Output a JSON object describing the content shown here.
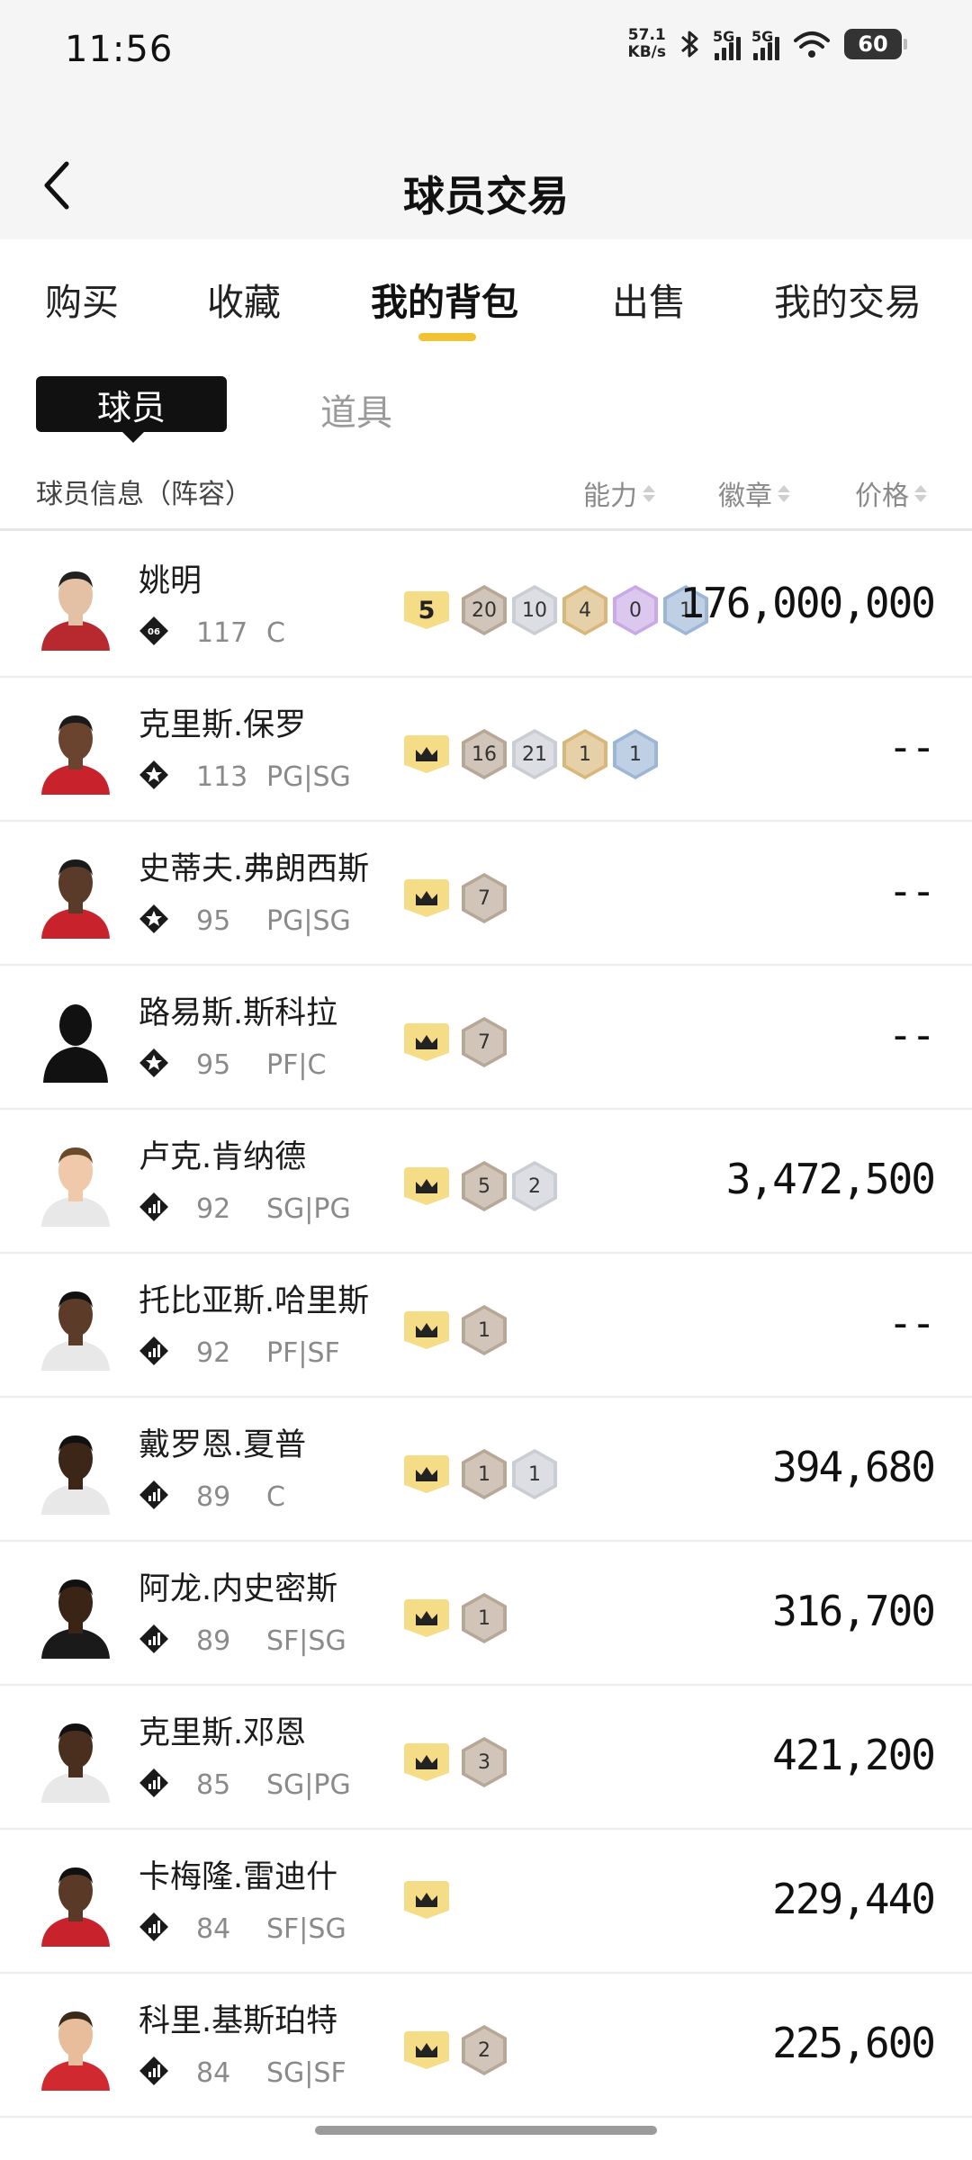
{
  "status_bar": {
    "time": "11:56",
    "net_speed_value": "57.1",
    "net_speed_unit": "KB/s",
    "signal1_label": "5G",
    "signal2_label": "5G",
    "battery": "60"
  },
  "header": {
    "title": "球员交易"
  },
  "tabs": [
    {
      "label": "购买",
      "active": false
    },
    {
      "label": "收藏",
      "active": false
    },
    {
      "label": "我的背包",
      "active": true
    },
    {
      "label": "出售",
      "active": false
    },
    {
      "label": "我的交易",
      "active": false
    }
  ],
  "subtabs": {
    "active": "球员",
    "other": "道具"
  },
  "columns": {
    "info": "球员信息（阵容）",
    "ability": "能力",
    "badge": "徽章",
    "price": "价格"
  },
  "colors": {
    "accent": "#f2c230",
    "ability_box": "#f5dc86"
  },
  "players": [
    {
      "name": "姚明",
      "tier": "06",
      "tier_icon": "diamond-06-icon",
      "ovr": "117",
      "pos": "C",
      "ability": "5",
      "badges": [
        {
          "n": "20",
          "c": "bronze"
        },
        {
          "n": "10",
          "c": "silver"
        },
        {
          "n": "4",
          "c": "gold"
        },
        {
          "n": "0",
          "c": "purple"
        },
        {
          "n": "1",
          "c": "blue"
        }
      ],
      "price": "176,000,000"
    },
    {
      "name": "克里斯.保罗",
      "tier": "star",
      "tier_icon": "star-diamond-icon",
      "ovr": "113",
      "pos": "PG|SG",
      "ability": "crown",
      "badges": [
        {
          "n": "16",
          "c": "bronze"
        },
        {
          "n": "21",
          "c": "silver"
        },
        {
          "n": "1",
          "c": "gold"
        },
        {
          "n": "1",
          "c": "blue"
        }
      ],
      "price": "--"
    },
    {
      "name": "史蒂夫.弗朗西斯",
      "tier": "star",
      "tier_icon": "star-diamond-icon",
      "ovr": "95",
      "pos": "PG|SG",
      "ability": "crown",
      "badges": [
        {
          "n": "7",
          "c": "bronze"
        }
      ],
      "price": "--"
    },
    {
      "name": "路易斯.斯科拉",
      "tier": "star",
      "tier_icon": "star-diamond-icon",
      "ovr": "95",
      "pos": "PF|C",
      "ability": "crown",
      "badges": [
        {
          "n": "7",
          "c": "bronze"
        }
      ],
      "price": "--"
    },
    {
      "name": "卢克.肯纳德",
      "tier": "bars",
      "tier_icon": "bars-diamond-icon",
      "ovr": "92",
      "pos": "SG|PG",
      "ability": "crown",
      "badges": [
        {
          "n": "5",
          "c": "bronze"
        },
        {
          "n": "2",
          "c": "silver"
        }
      ],
      "price": "3,472,500"
    },
    {
      "name": "托比亚斯.哈里斯",
      "tier": "bars",
      "tier_icon": "bars-diamond-icon",
      "ovr": "92",
      "pos": "PF|SF",
      "ability": "crown",
      "badges": [
        {
          "n": "1",
          "c": "bronze"
        }
      ],
      "price": "--"
    },
    {
      "name": "戴罗恩.夏普",
      "tier": "bars",
      "tier_icon": "bars-diamond-icon",
      "ovr": "89",
      "pos": "C",
      "ability": "crown",
      "badges": [
        {
          "n": "1",
          "c": "bronze"
        },
        {
          "n": "1",
          "c": "silver"
        }
      ],
      "price": "394,680"
    },
    {
      "name": "阿龙.内史密斯",
      "tier": "bars",
      "tier_icon": "bars-diamond-icon",
      "ovr": "89",
      "pos": "SF|SG",
      "ability": "crown",
      "badges": [
        {
          "n": "1",
          "c": "bronze"
        }
      ],
      "price": "316,700"
    },
    {
      "name": "克里斯.邓恩",
      "tier": "bars",
      "tier_icon": "bars-diamond-icon",
      "ovr": "85",
      "pos": "SG|PG",
      "ability": "crown",
      "badges": [
        {
          "n": "3",
          "c": "bronze"
        }
      ],
      "price": "421,200"
    },
    {
      "name": "卡梅隆.雷迪什",
      "tier": "bars",
      "tier_icon": "bars-diamond-icon",
      "ovr": "84",
      "pos": "SF|SG",
      "ability": "crown",
      "badges": [],
      "price": "229,440"
    },
    {
      "name": "科里.基斯珀特",
      "tier": "bars",
      "tier_icon": "bars-diamond-icon",
      "ovr": "84",
      "pos": "SG|SF",
      "ability": "crown",
      "badges": [
        {
          "n": "2",
          "c": "bronze"
        }
      ],
      "price": "225,600"
    }
  ]
}
